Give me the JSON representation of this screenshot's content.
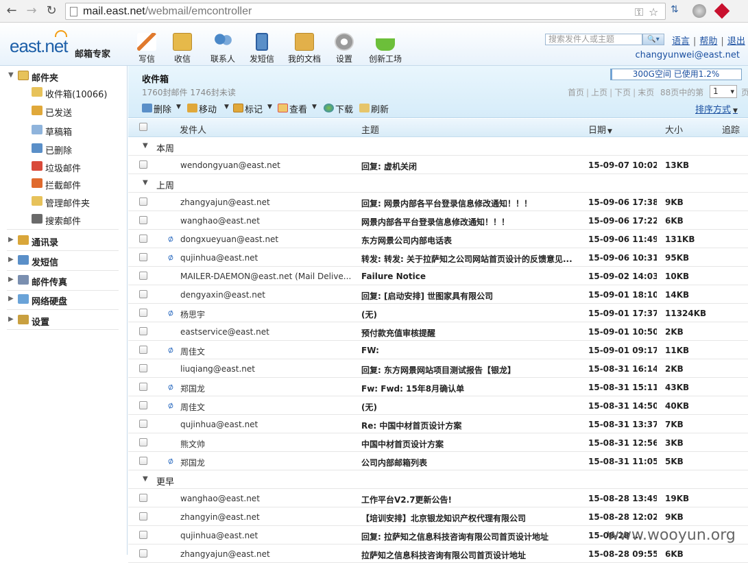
{
  "browser": {
    "url_host": "mail.east.net",
    "url_path": "/webmail/emcontroller"
  },
  "header": {
    "logo": "east.net",
    "logo_sub": "邮箱专家",
    "tools": [
      {
        "label": "写信",
        "icon": "pencil-icon",
        "color": "#e07a2e"
      },
      {
        "label": "收信",
        "icon": "inbox-check-icon",
        "color": "#e6b94a"
      },
      {
        "label": "联系人",
        "icon": "contacts-icon",
        "color": "#4a88c8"
      },
      {
        "label": "发短信",
        "icon": "phone-icon",
        "color": "#5a8fc8"
      },
      {
        "label": "我的文档",
        "icon": "folder-icon",
        "color": "#e2b04a"
      },
      {
        "label": "设置",
        "icon": "gear-icon",
        "color": "#9a9a9a"
      },
      {
        "label": "创新工场",
        "icon": "flask-icon",
        "color": "#6cbf3a"
      }
    ],
    "search_placeholder": "搜索发件人或主题",
    "links": {
      "language": "语言",
      "help": "帮助",
      "logout": "退出"
    },
    "user_email": "changyunwei@east.net"
  },
  "sidebar": {
    "mailbox_group": "邮件夹",
    "folders": [
      {
        "label": "收件箱(10066)",
        "icon": "inbox-folder-icon",
        "color": "#e7c25a"
      },
      {
        "label": "已发送",
        "icon": "sent-icon",
        "color": "#e0a83a"
      },
      {
        "label": "草稿箱",
        "icon": "draft-icon",
        "color": "#8fb4dc"
      },
      {
        "label": "已删除",
        "icon": "trash-icon",
        "color": "#5a8fc8"
      },
      {
        "label": "垃圾邮件",
        "icon": "spam-icon",
        "color": "#d94a3a"
      },
      {
        "label": "拦截邮件",
        "icon": "block-icon",
        "color": "#e06a2e"
      },
      {
        "label": "管理邮件夹",
        "icon": "manage-folder-icon",
        "color": "#e7c25a"
      },
      {
        "label": "搜索邮件",
        "icon": "search-icon",
        "color": "#6a6a6a"
      }
    ],
    "groups": [
      {
        "label": "通讯录",
        "icon": "address-book-icon",
        "color": "#d9a63a"
      },
      {
        "label": "发短信",
        "icon": "phone-icon",
        "color": "#5a8fc8"
      },
      {
        "label": "邮件传真",
        "icon": "fax-icon",
        "color": "#7a8fb0"
      },
      {
        "label": "网络硬盘",
        "icon": "disk-icon",
        "color": "#6aa3d8"
      },
      {
        "label": "设置",
        "icon": "gear-icon",
        "color": "#c9a040"
      }
    ]
  },
  "main": {
    "folder_title": "收件箱",
    "stats": "1760封邮件 1746封未读",
    "quota_text": "300G空间 已使用1.2%",
    "quota_fraction": 0.012,
    "pager": {
      "first": "首页",
      "prev": "上页",
      "next": "下页",
      "last": "末页",
      "total": "88页中的第",
      "page": "1",
      "unit": "页"
    },
    "toolbar": {
      "delete": "删除",
      "move": "移动",
      "mark": "标记",
      "view": "查看",
      "download": "下载",
      "refresh": "刷新"
    },
    "sort": "排序方式",
    "columns": {
      "sender": "发件人",
      "subject": "主题",
      "date": "日期",
      "size": "大小",
      "track": "追踪"
    },
    "groups": [
      {
        "label": "本周",
        "rows": [
          {
            "sender": "wendongyuan@east.net",
            "subject": "回复: 虚机关闭",
            "date": "15-09-07 10:02",
            "size": "13KB",
            "attach": false
          }
        ]
      },
      {
        "label": "上周",
        "rows": [
          {
            "sender": "zhangyajun@east.net",
            "subject": "回复: 网景内部各平台登录信息修改通知！！！",
            "date": "15-09-06 17:38",
            "size": "9KB",
            "attach": false
          },
          {
            "sender": "wanghao@east.net",
            "subject": "网景内部各平台登录信息修改通知！！！",
            "date": "15-09-06 17:22",
            "size": "6KB",
            "attach": false
          },
          {
            "sender": "dongxueyuan@east.net",
            "subject": "东方网景公司内部电话表",
            "date": "15-09-06 11:49",
            "size": "131KB",
            "attach": true
          },
          {
            "sender": "qujinhua@east.net",
            "subject": "转发: 转发: 关于拉萨知之公司网站首页设计的反馈意见...",
            "date": "15-09-06 10:31",
            "size": "95KB",
            "attach": true
          },
          {
            "sender": "MAILER-DAEMON@east.net (Mail Delive...",
            "subject": "Failure Notice",
            "date": "15-09-02 14:03",
            "size": "10KB",
            "attach": false
          },
          {
            "sender": "dengyaxin@east.net",
            "subject": "回复: [启动安排] 世图家具有限公司",
            "date": "15-09-01 18:10",
            "size": "14KB",
            "attach": false
          },
          {
            "sender": "杨思宇",
            "subject": "(无)",
            "date": "15-09-01 17:37",
            "size": "11324KB",
            "attach": true
          },
          {
            "sender": "eastservice@east.net",
            "subject": "预付款充值审核提醒",
            "date": "15-09-01 10:50",
            "size": "2KB",
            "attach": false
          },
          {
            "sender": "周佳文",
            "subject": "FW:",
            "date": "15-09-01 09:17",
            "size": "11KB",
            "attach": true
          },
          {
            "sender": "liuqiang@east.net",
            "subject": "回复: 东方网景网站项目测试报告【银龙】",
            "date": "15-08-31 16:14",
            "size": "2KB",
            "attach": false
          },
          {
            "sender": "郑国龙",
            "subject": "Fw: Fwd: 15年8月确认单",
            "date": "15-08-31 15:11",
            "size": "43KB",
            "attach": true
          },
          {
            "sender": "周佳文",
            "subject": "(无)",
            "date": "15-08-31 14:50",
            "size": "40KB",
            "attach": true
          },
          {
            "sender": "qujinhua@east.net",
            "subject": "Re: 中国中材首页设计方案",
            "date": "15-08-31 13:37",
            "size": "7KB",
            "attach": false
          },
          {
            "sender": "熊文帅",
            "subject": "中国中材首页设计方案",
            "date": "15-08-31 12:56",
            "size": "3KB",
            "attach": false
          },
          {
            "sender": "郑国龙",
            "subject": "公司内部邮箱列表",
            "date": "15-08-31 11:05",
            "size": "5KB",
            "attach": true
          }
        ]
      },
      {
        "label": "更早",
        "rows": [
          {
            "sender": "wanghao@east.net",
            "subject": "工作平台V2.7更新公告!",
            "date": "15-08-28 13:49",
            "size": "19KB",
            "attach": false
          },
          {
            "sender": "zhangyin@east.net",
            "subject": "【培训安排】北京银龙知识产权代理有限公司",
            "date": "15-08-28 12:02",
            "size": "9KB",
            "attach": false
          },
          {
            "sender": "qujinhua@east.net",
            "subject": "回复: 拉萨知之信息科技咨询有限公司首页设计地址",
            "date": "15-08-28 ...",
            "size": "",
            "attach": false
          },
          {
            "sender": "zhangyajun@east.net",
            "subject": "拉萨知之信息科技咨询有限公司首页设计地址",
            "date": "15-08-28 09:55",
            "size": "6KB",
            "attach": false
          }
        ]
      }
    ]
  },
  "watermark": "www.wooyun.org"
}
